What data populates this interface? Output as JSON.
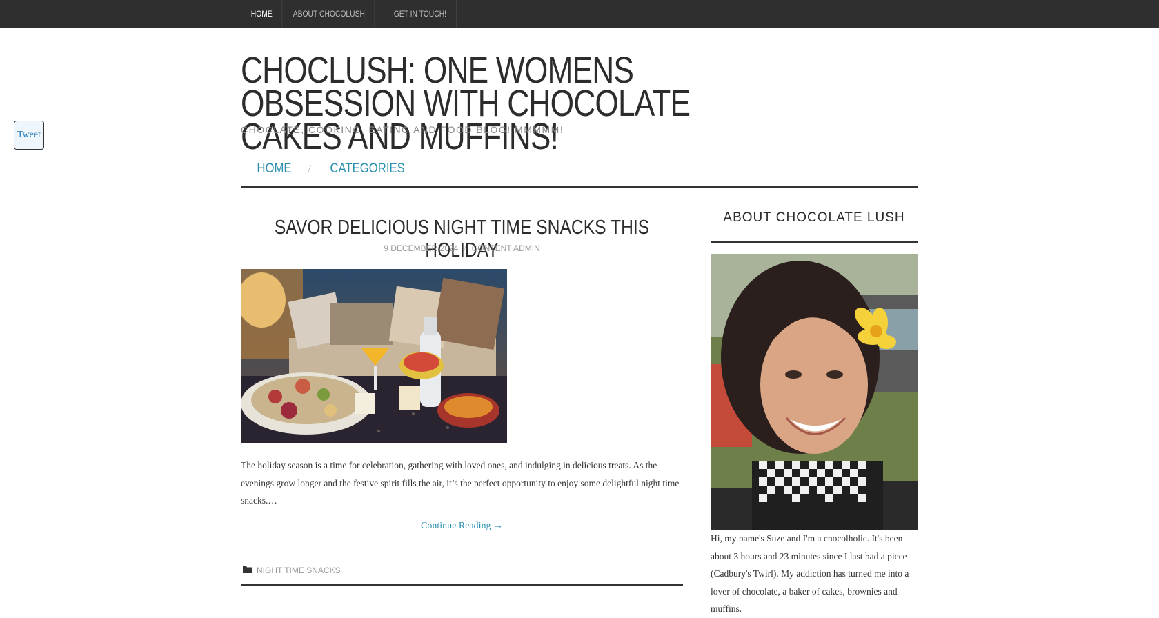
{
  "top_nav": {
    "items": [
      "Home",
      "About Chocolush",
      "Get in touch!"
    ]
  },
  "tweet_label": "Tweet",
  "site": {
    "title": "Choclush: One womens obsession with chocolate cakes and muffins!",
    "description": "Choclate, cooking, eating and food blog! Mmmmm!"
  },
  "main_nav": {
    "items": [
      "Home",
      "Categories"
    ],
    "separator": "/"
  },
  "post": {
    "title": "Savor Delicious Night Time Snacks This Holiday",
    "date": "9 December 2024",
    "meta_separator": "/",
    "author": "Content Admin",
    "excerpt": "The holiday season is a time for celebration, gathering with loved ones, and indulging in delicious treats. As the evenings grow longer and the festive spirit fills the air, it’s the perfect opportunity to enjoy some delightful night time snacks.…",
    "continue_label": "Continue Reading →",
    "category": "Night Time Snacks"
  },
  "sidebar": {
    "widget_title": "About Chocolate Lush",
    "about_text": "Hi, my name's Suze and I'm a chocolholic. It's been about 3 hours and 23 minutes since I last had a piece (Cadbury's Twirl). My addiction has turned me into a lover of chocolate, a baker of cakes, brownies and muffins."
  },
  "colors": {
    "topbar": "#2f2f2f",
    "link": "#2a8fb0",
    "text": "#333333"
  },
  "icons": {
    "category": "folder-icon"
  }
}
